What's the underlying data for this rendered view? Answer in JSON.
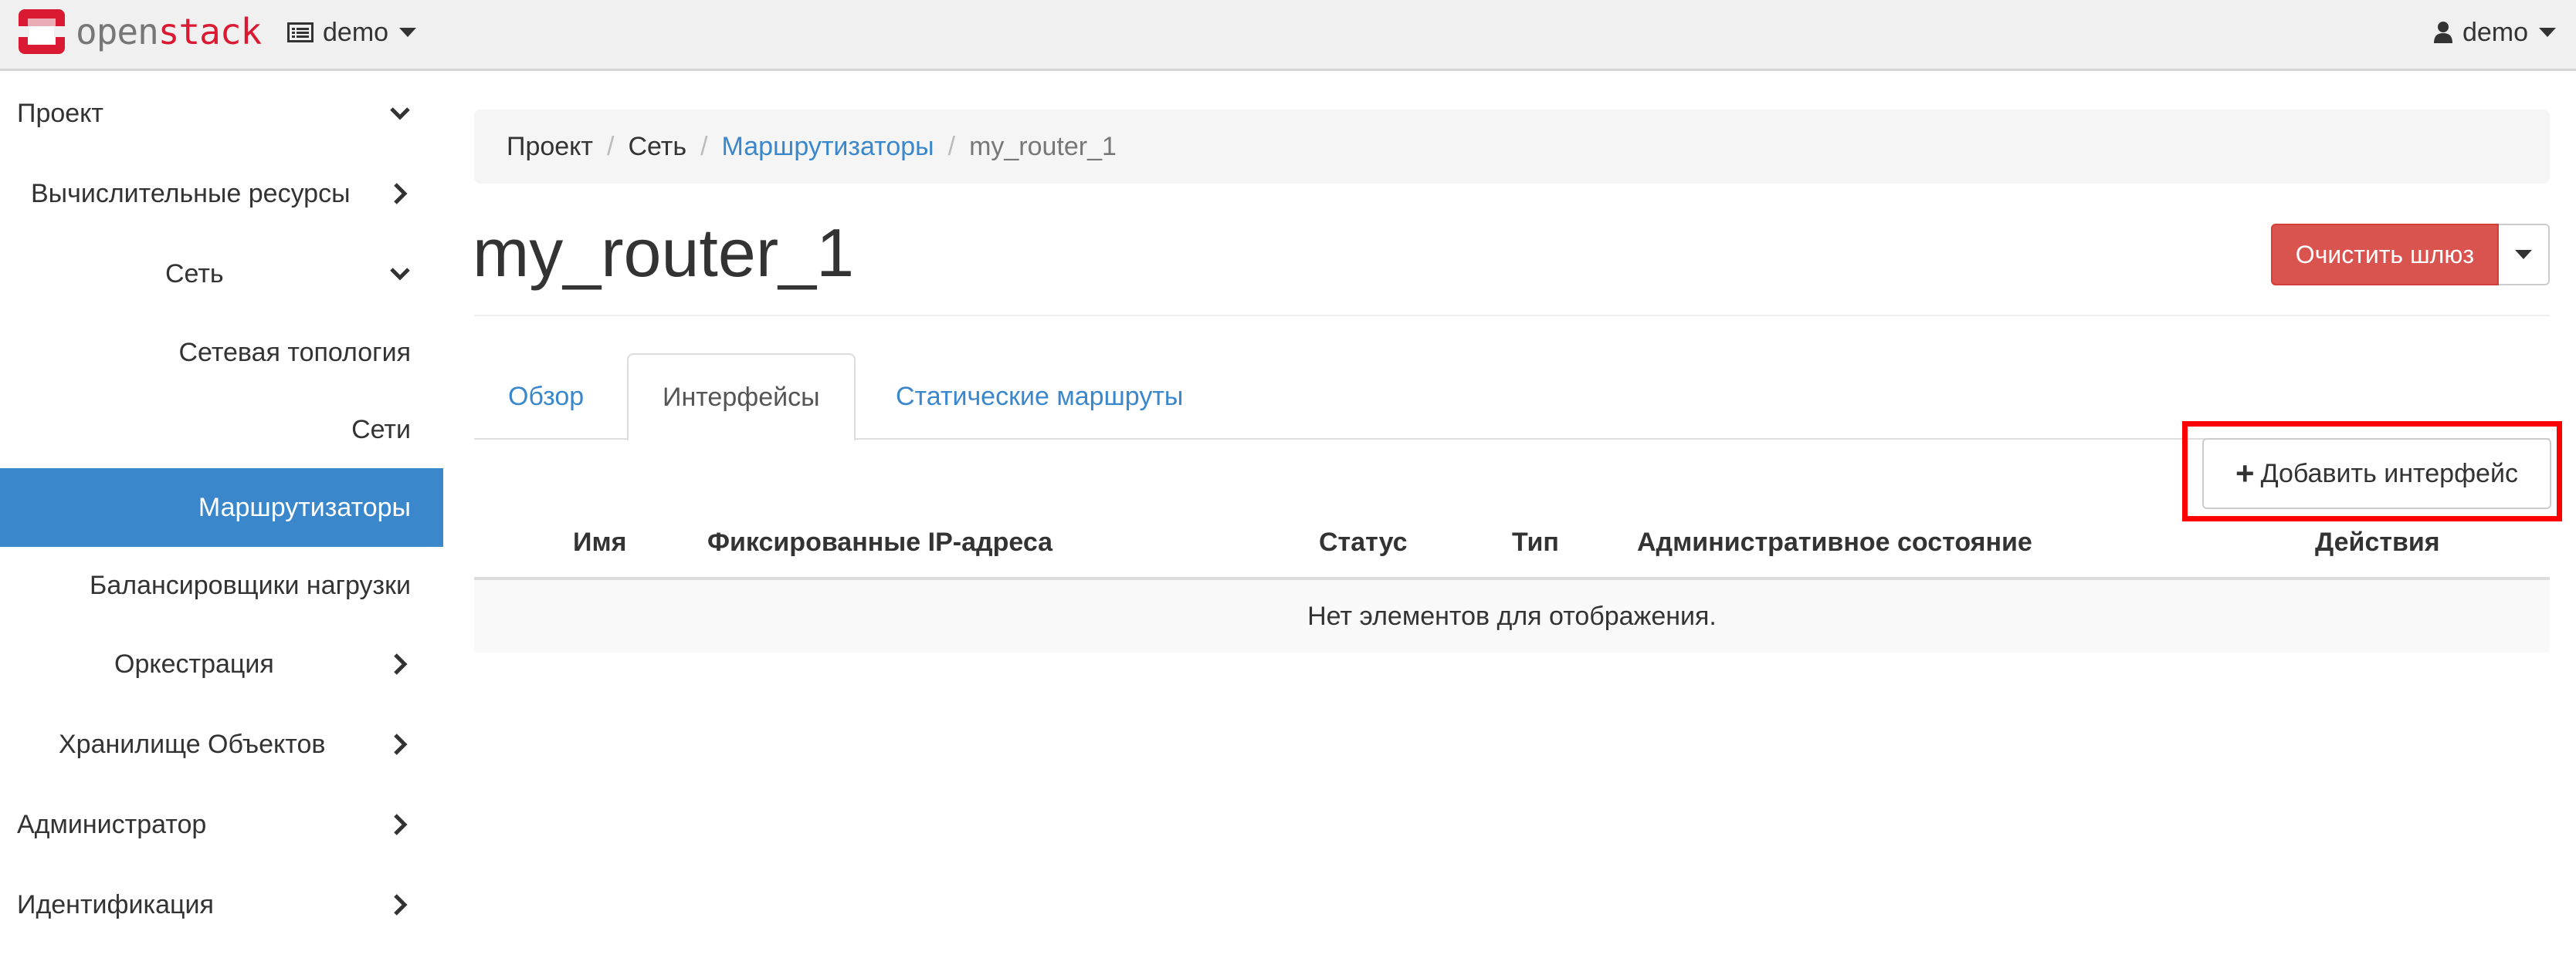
{
  "header": {
    "logo": {
      "part1": "open",
      "part2": "stack"
    },
    "project_switcher": {
      "label": "demo",
      "icon": "project-icon"
    },
    "user_menu": {
      "label": "demo",
      "icon": "user-icon"
    }
  },
  "sidebar": {
    "items": [
      {
        "label": "Проект",
        "chevron": "down"
      },
      {
        "label": "Вычислительные ресурсы",
        "chevron": "right"
      },
      {
        "label": "Сеть",
        "chevron": "down"
      },
      {
        "label": "Сетевая топология"
      },
      {
        "label": "Сети"
      },
      {
        "label": "Маршрутизаторы",
        "active": true
      },
      {
        "label": "Балансировщики нагрузки"
      },
      {
        "label": "Оркестрация",
        "chevron": "right"
      },
      {
        "label": "Хранилище Объектов",
        "chevron": "right"
      },
      {
        "label": "Администратор",
        "chevron": "right"
      },
      {
        "label": "Идентификация",
        "chevron": "right"
      }
    ]
  },
  "breadcrumb": {
    "items": [
      {
        "label": "Проект"
      },
      {
        "label": "Сеть"
      },
      {
        "label": "Маршрутизаторы",
        "link": true
      },
      {
        "label": "my_router_1",
        "current": true
      }
    ],
    "separator": "/"
  },
  "page": {
    "title": "my_router_1",
    "clear_gateway_label": "Очистить шлюз"
  },
  "tabs": [
    {
      "label": "Обзор"
    },
    {
      "label": "Интерфейсы",
      "active": true
    },
    {
      "label": "Статические маршруты"
    }
  ],
  "table": {
    "add_interface_label": "Добавить интерфейс",
    "columns": [
      "Имя",
      "Фиксированные IP-адреса",
      "Статус",
      "Тип",
      "Административное состояние",
      "Действия"
    ],
    "empty_message": "Нет элементов для отображения."
  },
  "colors": {
    "primary": "#3a87cc",
    "danger": "#d9534f",
    "highlight": "#ff0000",
    "brand_red": "#da1a32"
  }
}
